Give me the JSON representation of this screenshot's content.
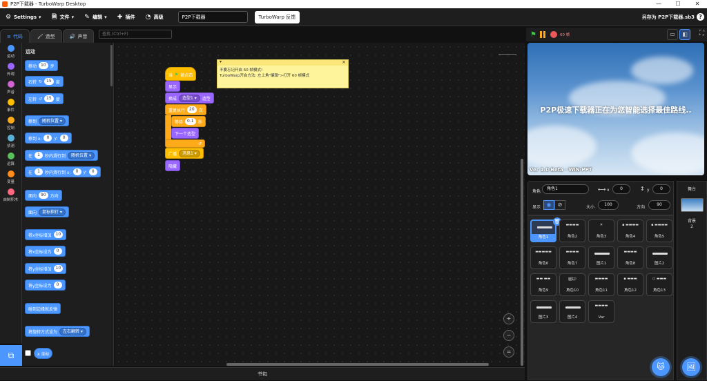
{
  "window": {
    "title": "P2P下载器 - TurboWarp Desktop",
    "min": "—",
    "max": "☐",
    "close": "✕"
  },
  "menu": {
    "settings": "Settings",
    "file": "文件",
    "edit": "编辑",
    "addons": "插件",
    "advanced": "高级",
    "project_title": "P2P下载器",
    "feedback": "TurboWarp 反馈",
    "save_as": "另存为 P2P下载器.sb3",
    "help": "?"
  },
  "tabs": {
    "code": "代码",
    "costumes": "造型",
    "sounds": "声音"
  },
  "search": {
    "placeholder": "查找 (Ctrl+F)"
  },
  "categories": [
    {
      "label": "运动",
      "color": "#4c97ff"
    },
    {
      "label": "外观",
      "color": "#9966ff"
    },
    {
      "label": "声音",
      "color": "#cf63cf"
    },
    {
      "label": "事件",
      "color": "#ffbf00"
    },
    {
      "label": "控制",
      "color": "#ffab19"
    },
    {
      "label": "侦测",
      "color": "#5cb1d6"
    },
    {
      "label": "运算",
      "color": "#59c059"
    },
    {
      "label": "变量",
      "color": "#ff8c1a"
    },
    {
      "label": "自制积木",
      "color": "#ff6680"
    }
  ],
  "palette": {
    "heading": "运动",
    "move": {
      "a": "移动",
      "n": "10",
      "b": "步"
    },
    "turn_right": {
      "a": "右转",
      "icon": "↻",
      "n": "15",
      "b": "度"
    },
    "turn_left": {
      "a": "左转",
      "icon": "↺",
      "n": "15",
      "b": "度"
    },
    "goto": {
      "a": "移到",
      "dd": "随机位置 ▾"
    },
    "gotoxy": {
      "a": "移到 x:",
      "x": "0",
      "b": "y:",
      "y": "0"
    },
    "glide": {
      "a": "在",
      "n": "1",
      "b": "秒内滑行到",
      "dd": "随机位置 ▾"
    },
    "glidexy": {
      "a": "在",
      "n": "1",
      "b": "秒内滑行到 x:",
      "x": "0",
      "c": "y:",
      "y": "0"
    },
    "point": {
      "a": "面向",
      "n": "90",
      "b": "方向"
    },
    "point_towards": {
      "a": "面向",
      "dd": "鼠标指针 ▾"
    },
    "change_x": {
      "a": "将x坐标增加",
      "n": "10"
    },
    "set_x": {
      "a": "将x坐标设为",
      "n": "0"
    },
    "change_y": {
      "a": "将y坐标增加",
      "n": "10"
    },
    "set_y": {
      "a": "将y坐标设为",
      "n": "0"
    },
    "bounce": {
      "a": "碰到边缘就反弹"
    },
    "rotation": {
      "a": "将旋转方式设为",
      "dd": "左右翻转 ▾"
    },
    "xpos": {
      "a": "x 坐标"
    }
  },
  "script": {
    "hat": {
      "a": "当",
      "flag": "⚑",
      "b": "被点击"
    },
    "show": "显示",
    "switch": {
      "a": "换成",
      "dd": "造型1 ▾",
      "b": "造型"
    },
    "repeat": {
      "a": "重复执行",
      "n": "20",
      "b": "次"
    },
    "wait": {
      "a": "等待",
      "n": "0.1",
      "b": "秒"
    },
    "next": "下一个造型",
    "loop_arrow": "↺",
    "broadcast": {
      "a": "广播",
      "dd": "消息1 ▾"
    },
    "hide": "隐藏"
  },
  "comment": {
    "line1": "不要忘记开启 60 帧模式!",
    "line2": "TurboWarp开启方法: 左上角\"编辑\">打开 60 帧模式"
  },
  "zoom": {
    "in": "+",
    "out": "−",
    "reset": "="
  },
  "backpack": "书包",
  "stage_header": {
    "fps": "60 帧"
  },
  "stage": {
    "text": "P2P极速下载器正在为您智能选择最佳路线..",
    "version": "Ver 1.0 Beta - WIN-PPT"
  },
  "sprite_info": {
    "sprite_label": "角色",
    "sprite_name": "角色1",
    "x_label": "x",
    "x": "0",
    "y_label": "y",
    "y": "0",
    "show_label": "显示",
    "size_label": "大小",
    "size": "100",
    "direction_label": "方向",
    "direction": "90"
  },
  "sprites": [
    {
      "name": "角色1",
      "thumb": ""
    },
    {
      "name": "角色2",
      "thumb": "▬▬▬▬"
    },
    {
      "name": "角色3",
      "thumb": "✕"
    },
    {
      "name": "角色4",
      "thumb": "▪ ▬▬▬▬"
    },
    {
      "name": "角色5",
      "thumb": "▪ ▬▬▬▬"
    },
    {
      "name": "角色6",
      "thumb": "▬▬▬▬▬"
    },
    {
      "name": "角色7",
      "thumb": "▬▬▬▬"
    },
    {
      "name": "图片1",
      "thumb": ""
    },
    {
      "name": "角色8",
      "thumb": "▬▬▬▬"
    },
    {
      "name": "图片2",
      "thumb": ""
    },
    {
      "name": "角色9",
      "thumb": "▬▬ ▬▬"
    },
    {
      "name": "角色10",
      "thumb": "腿好!"
    },
    {
      "name": "角色11",
      "thumb": "▬▬▬▬"
    },
    {
      "name": "角色12",
      "thumb": "▪ ▬▬▬"
    },
    {
      "name": "角色13",
      "thumb": "○ ▬▬▬"
    },
    {
      "name": "图片3",
      "thumb": ""
    },
    {
      "name": "图片4",
      "thumb": ""
    },
    {
      "name": "Var",
      "thumb": "▬▬▬▬"
    }
  ],
  "stage_panel": {
    "title": "舞台",
    "backdrops_label": "背景",
    "backdrops_count": "2"
  },
  "colors": {
    "motion": "#4c97ff",
    "looks": "#9966ff",
    "events": "#ffbf00",
    "control": "#ffab19",
    "accent": "#4c97ff"
  }
}
